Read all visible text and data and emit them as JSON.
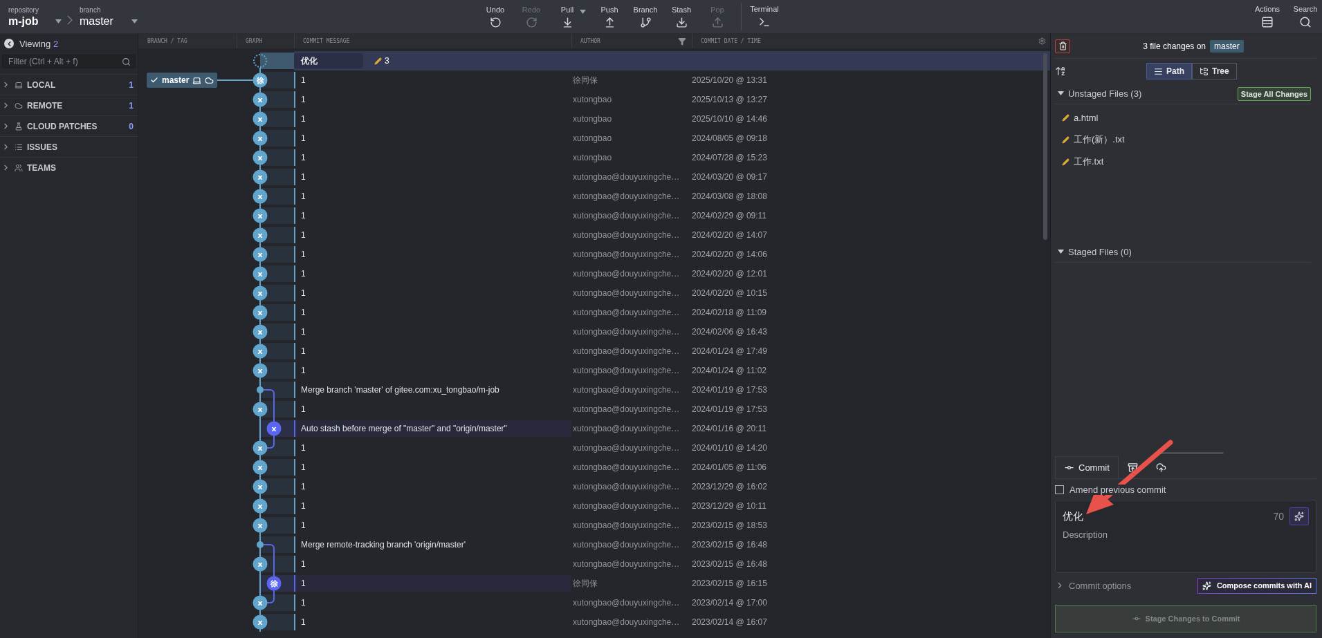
{
  "toolbar": {
    "repository_label": "repository",
    "repository": "m-job",
    "branch_label": "branch",
    "branch": "master",
    "actions": [
      {
        "kind": "undo",
        "label": "Undo",
        "disabled": false
      },
      {
        "kind": "redo",
        "label": "Redo",
        "disabled": true
      },
      {
        "kind": "pull",
        "label": "Pull",
        "disabled": false,
        "dropdown": true
      },
      {
        "kind": "push",
        "label": "Push",
        "disabled": false
      },
      {
        "kind": "branch",
        "label": "Branch",
        "disabled": false
      },
      {
        "kind": "stash",
        "label": "Stash",
        "disabled": false
      },
      {
        "kind": "pop",
        "label": "Pop",
        "disabled": true
      }
    ],
    "terminal": "Terminal",
    "right": [
      {
        "kind": "actions",
        "label": "Actions"
      },
      {
        "kind": "search",
        "label": "Search"
      }
    ]
  },
  "sidebar": {
    "viewing_label": "Viewing",
    "viewing_count": "2",
    "filter_placeholder": "Filter (Ctrl + Alt + f)",
    "sections": [
      {
        "kind": "local",
        "label": "LOCAL",
        "count": "1",
        "expanded": false
      },
      {
        "kind": "remote",
        "label": "REMOTE",
        "count": "1",
        "expanded": false
      },
      {
        "kind": "cloud_patches",
        "label": "CLOUD PATCHES",
        "count": "0",
        "expanded": false
      },
      {
        "kind": "issues",
        "label": "ISSUES",
        "expanded": false
      },
      {
        "kind": "teams",
        "label": "TEAMS",
        "expanded": false
      }
    ]
  },
  "graph": {
    "columns": [
      "BRANCH / TAG",
      "GRAPH",
      "COMMIT MESSAGE",
      "AUTHOR",
      "COMMIT DATE / TIME"
    ],
    "wip": {
      "message": "优化",
      "changes": "3"
    },
    "rows": [
      {
        "kind": "commit",
        "avatar": "徐",
        "message": "1",
        "author": "徐同保",
        "date": "2025/10/20 @ 13:31",
        "refs": [
          {
            "name": "master",
            "checked_out": true,
            "local": true,
            "remote": true
          }
        ]
      },
      {
        "kind": "commit",
        "avatar": "x",
        "message": "1",
        "author": "xutongbao",
        "date": "2025/10/13 @ 13:27"
      },
      {
        "kind": "commit",
        "avatar": "x",
        "message": "1",
        "author": "xutongbao",
        "date": "2025/10/10 @ 14:46"
      },
      {
        "kind": "commit",
        "avatar": "x",
        "message": "1",
        "author": "xutongbao",
        "date": "2024/08/05 @ 09:18"
      },
      {
        "kind": "commit",
        "avatar": "x",
        "message": "1",
        "author": "xutongbao",
        "date": "2024/07/28 @ 15:23"
      },
      {
        "kind": "commit",
        "avatar": "x",
        "message": "1",
        "author": "xutongbao@douyuxingche…",
        "date": "2024/03/20 @ 09:17"
      },
      {
        "kind": "commit",
        "avatar": "x",
        "message": "1",
        "author": "xutongbao@douyuxingche…",
        "date": "2024/03/08 @ 18:08"
      },
      {
        "kind": "commit",
        "avatar": "x",
        "message": "1",
        "author": "xutongbao@douyuxingche…",
        "date": "2024/02/29 @ 09:11"
      },
      {
        "kind": "commit",
        "avatar": "x",
        "message": "1",
        "author": "xutongbao@douyuxingche…",
        "date": "2024/02/20 @ 14:07"
      },
      {
        "kind": "commit",
        "avatar": "x",
        "message": "1",
        "author": "xutongbao@douyuxingche…",
        "date": "2024/02/20 @ 14:06"
      },
      {
        "kind": "commit",
        "avatar": "x",
        "message": "1",
        "author": "xutongbao@douyuxingche…",
        "date": "2024/02/20 @ 12:01"
      },
      {
        "kind": "commit",
        "avatar": "x",
        "message": "1",
        "author": "xutongbao@douyuxingche…",
        "date": "2024/02/20 @ 10:15"
      },
      {
        "kind": "commit",
        "avatar": "x",
        "message": "1",
        "author": "xutongbao@douyuxingche…",
        "date": "2024/02/18 @ 11:09"
      },
      {
        "kind": "commit",
        "avatar": "x",
        "message": "1",
        "author": "xutongbao@douyuxingche…",
        "date": "2024/02/06 @ 16:43"
      },
      {
        "kind": "commit",
        "avatar": "x",
        "message": "1",
        "author": "xutongbao@douyuxingche…",
        "date": "2024/01/24 @ 17:49"
      },
      {
        "kind": "commit",
        "avatar": "x",
        "message": "1",
        "author": "xutongbao@douyuxingche…",
        "date": "2024/01/24 @ 11:02"
      },
      {
        "kind": "merge",
        "message": "Merge branch 'master' of gitee.com:xu_tongbao/m-job",
        "author": "xutongbao@douyuxingche…",
        "date": "2024/01/19 @ 17:53"
      },
      {
        "kind": "commit-branch-pass",
        "avatar": "x",
        "message": "1",
        "author": "xutongbao@douyuxingche…",
        "date": "2024/01/19 @ 17:53"
      },
      {
        "kind": "side-commit",
        "avatar": "x",
        "message": "Auto stash before merge of \"master\" and \"origin/master\"",
        "author": "xutongbao@douyuxingche…",
        "date": "2024/01/16 @ 20:11"
      },
      {
        "kind": "commit-branch-end",
        "avatar": "x",
        "message": "1",
        "author": "xutongbao@douyuxingche…",
        "date": "2024/01/10 @ 14:20"
      },
      {
        "kind": "commit",
        "avatar": "x",
        "message": "1",
        "author": "xutongbao@douyuxingche…",
        "date": "2024/01/05 @ 11:06"
      },
      {
        "kind": "commit",
        "avatar": "x",
        "message": "1",
        "author": "xutongbao@douyuxingche…",
        "date": "2023/12/29 @ 16:02"
      },
      {
        "kind": "commit",
        "avatar": "x",
        "message": "1",
        "author": "xutongbao@douyuxingche…",
        "date": "2023/12/29 @ 10:11"
      },
      {
        "kind": "commit",
        "avatar": "x",
        "message": "1",
        "author": "xutongbao@douyuxingche…",
        "date": "2023/02/15 @ 18:53"
      },
      {
        "kind": "merge",
        "message": "Merge remote-tracking branch 'origin/master'",
        "author": "xutongbao@douyuxingche…",
        "date": "2023/02/15 @ 16:48"
      },
      {
        "kind": "commit-branch-pass",
        "avatar": "x",
        "message": "1",
        "author": "xutongbao@douyuxingche…",
        "date": "2023/02/15 @ 16:48"
      },
      {
        "kind": "side-commit",
        "avatar": "徐",
        "message": "1",
        "author": "徐同保",
        "date": "2023/02/15 @ 16:15"
      },
      {
        "kind": "commit-branch-end",
        "avatar": "x",
        "message": "1",
        "author": "xutongbao@douyuxingche…",
        "date": "2023/02/14 @ 17:00"
      },
      {
        "kind": "commit",
        "avatar": "x",
        "message": "1",
        "author": "xutongbao@douyuxingche…",
        "date": "2023/02/14 @ 16:07"
      }
    ]
  },
  "changes": {
    "summary": "3 file changes on",
    "branch": "master",
    "views": [
      {
        "kind": "path",
        "label": "Path",
        "selected": true
      },
      {
        "kind": "tree",
        "label": "Tree",
        "selected": false
      }
    ],
    "unstaged": {
      "title": "Unstaged Files (3)",
      "expanded": true,
      "action": "Stage All Changes",
      "files": [
        "a.html",
        "工作(新）.txt",
        "工作.txt"
      ]
    },
    "staged": {
      "title": "Staged Files (0)",
      "expanded": true
    }
  },
  "commit": {
    "tabs": [
      {
        "kind": "commit",
        "label": "Commit",
        "selected": true
      },
      {
        "kind": "stash",
        "selected": false
      },
      {
        "kind": "cloud",
        "selected": false
      }
    ],
    "amend": {
      "label": "Amend previous commit",
      "checked": false
    },
    "summary": "优化",
    "remaining": "70",
    "description_placeholder": "Description",
    "options": "Commit options",
    "compose": "Compose commits with AI",
    "submit": {
      "label": "Stage Changes to Commit",
      "disabled": true
    }
  }
}
